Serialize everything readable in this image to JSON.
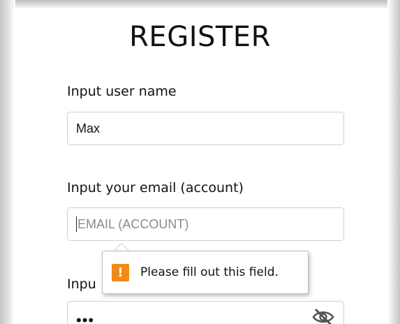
{
  "form": {
    "title": "REGISTER",
    "username": {
      "label": "Input user name",
      "value": "Max"
    },
    "email": {
      "label": "Input your email (account)",
      "placeholder": "EMAIL (ACCOUNT)",
      "value": ""
    },
    "password": {
      "label_visible": "Inpu",
      "value_masked": "•••"
    }
  },
  "validation_tooltip": {
    "icon": "warning-icon",
    "message": "Please fill out this field.",
    "icon_color": "#f08a14"
  }
}
